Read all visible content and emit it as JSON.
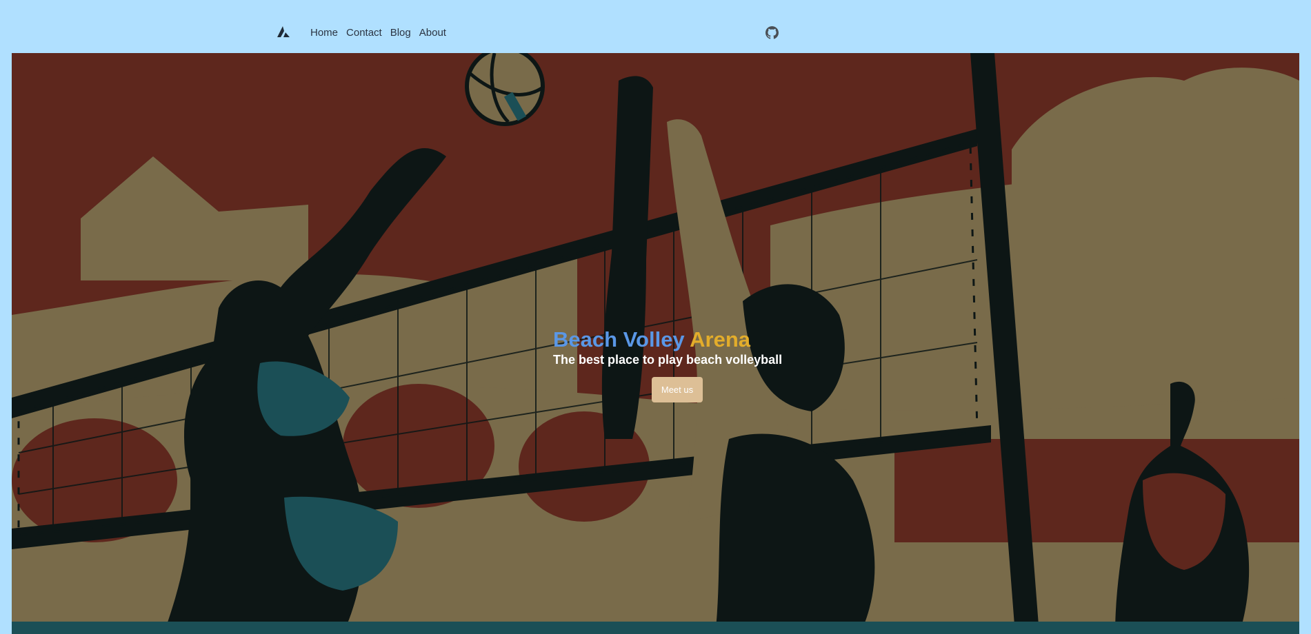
{
  "navbar": {
    "brand_icon": "triangle-logo-icon",
    "links": [
      {
        "label": "Home"
      },
      {
        "label": "Contact"
      },
      {
        "label": "Blog"
      },
      {
        "label": "About"
      }
    ],
    "github_icon": "github-icon"
  },
  "hero": {
    "title_part1": "Beach Volley",
    "title_part2": "Arena",
    "subtitle": "The best place to play beach volleyball",
    "cta_label": "Meet us"
  },
  "colors": {
    "page_background": "#b0e0ff",
    "title_blue": "#5a97e6",
    "title_gold": "#e3ad2b",
    "cta_background": "#ddbf96",
    "illustration_red": "#6b2d22",
    "illustration_tan": "#8a7a55",
    "illustration_dark": "#0f1a19",
    "illustration_teal": "#1f5a62"
  }
}
